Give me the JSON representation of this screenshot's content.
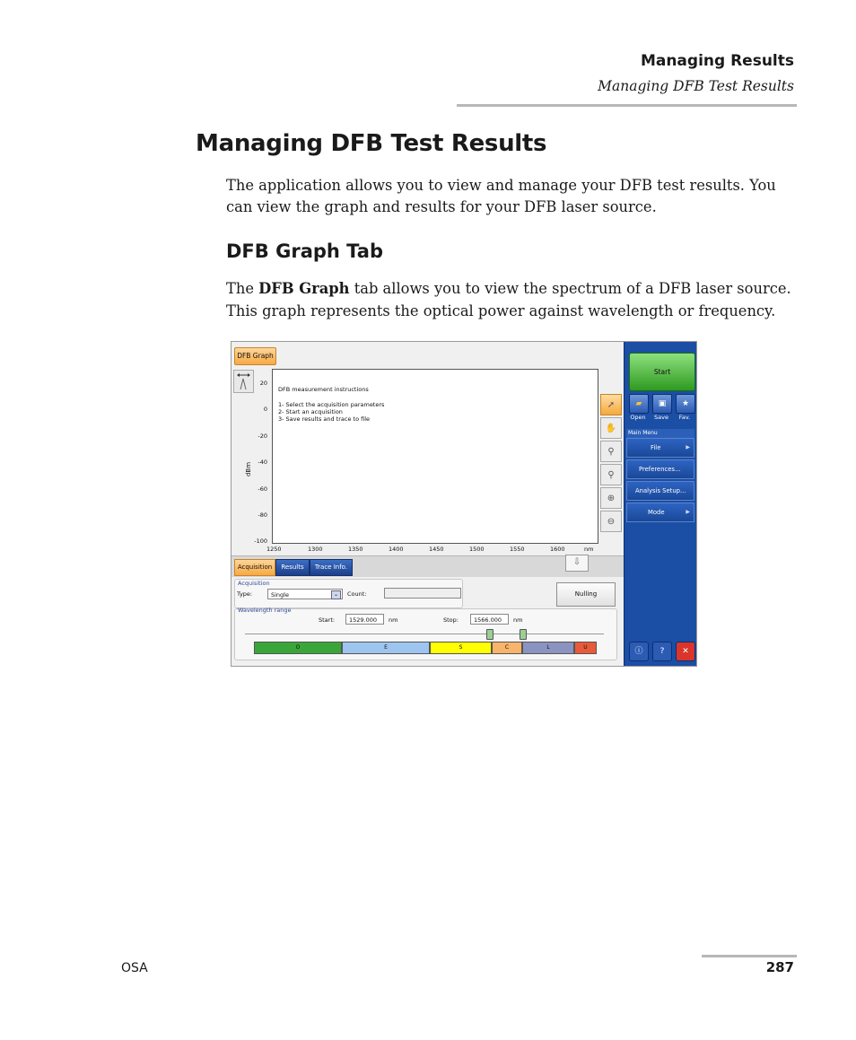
{
  "header": {
    "chapter": "Managing Results",
    "section": "Managing DFB Test Results"
  },
  "heading": "Managing DFB Test Results",
  "intro": "The application allows you to view and manage your DFB test results. You can view the graph and results for your DFB laser source.",
  "subheading": "DFB Graph Tab",
  "body": {
    "pre": "The ",
    "bold": "DFB Graph",
    "post": " tab allows you to view the spectrum of a DFB laser source. This graph represents the optical power against wavelength or frequency."
  },
  "footer": {
    "left": "OSA",
    "page": "287"
  },
  "screenshot": {
    "tab_dfb": "DFB Graph",
    "plot": {
      "y_title": "dBm",
      "y_ticks": [
        "20",
        "0",
        "-20",
        "-40",
        "-60",
        "-80",
        "-100"
      ],
      "x_ticks": [
        "1250",
        "1300",
        "1350",
        "1400",
        "1450",
        "1500",
        "1550",
        "1600"
      ],
      "x_unit": "nm",
      "instructions": {
        "title": "DFB measurement instructions",
        "step1": "1- Select the acquisition parameters",
        "step2": "2- Start an acquisition",
        "step3": "3- Save results and trace to file"
      }
    },
    "lower_tabs": [
      "Acquisition",
      "Results",
      "Trace Info."
    ],
    "acquisition": {
      "group_title": "Acquisition",
      "type_label": "Type:",
      "type_value": "Single",
      "count_label": "Count:",
      "count_value": "",
      "nulling_button": "Nulling"
    },
    "wavelength": {
      "group_title": "Wavelength range",
      "start_label": "Start:",
      "start_value": "1529.000",
      "start_unit": "nm",
      "stop_label": "Stop:",
      "stop_value": "1566.000",
      "stop_unit": "nm",
      "bands": [
        "O",
        "E",
        "S",
        "C",
        "L",
        "U"
      ]
    },
    "band_colors": [
      "#3aa63a",
      "#9ec5f0",
      "#ffff00",
      "#f7b46a",
      "#8b93c0",
      "#e85a3a"
    ],
    "side": {
      "start_button": "Start",
      "open": "Open",
      "save": "Save",
      "fav": "Fav.",
      "main_menu": "Main Menu",
      "file": "File",
      "preferences": "Preferences...",
      "analysis_setup": "Analysis Setup...",
      "mode": "Mode"
    }
  }
}
